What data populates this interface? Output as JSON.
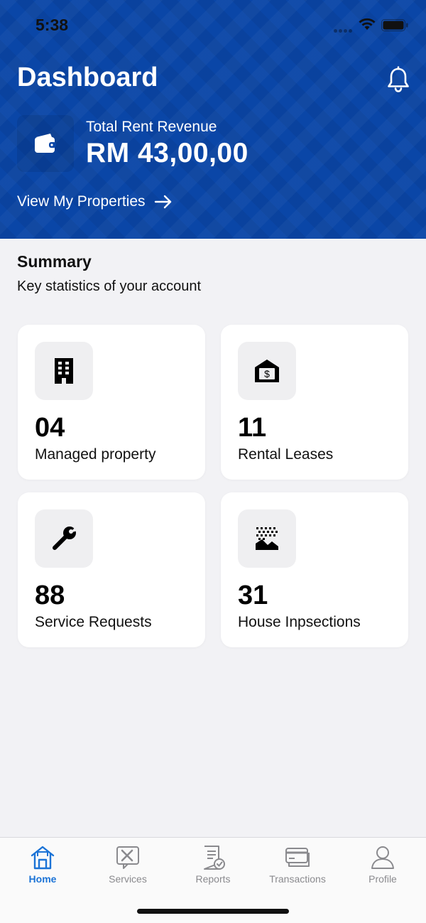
{
  "status_bar": {
    "time": "5:38"
  },
  "header": {
    "title": "Dashboard",
    "revenue_label": "Total Rent Revenue",
    "revenue_value": "RM 43,00,00",
    "view_link": "View My Properties"
  },
  "summary": {
    "title": "Summary",
    "subtitle": "Key statistics of your account",
    "cards": [
      {
        "value": "04",
        "label": "Managed property",
        "icon": "building-icon"
      },
      {
        "value": "11",
        "label": "Rental Leases",
        "icon": "house-dollar-icon"
      },
      {
        "value": "88",
        "label": "Service Requests",
        "icon": "wrench-icon"
      },
      {
        "value": "31",
        "label": "House Inpsections",
        "icon": "landscape-inspection-icon"
      }
    ]
  },
  "tabbar": {
    "tabs": [
      {
        "label": "Home",
        "icon": "home-icon",
        "active": true
      },
      {
        "label": "Services",
        "icon": "services-icon",
        "active": false
      },
      {
        "label": "Reports",
        "icon": "reports-icon",
        "active": false
      },
      {
        "label": "Transactions",
        "icon": "transactions-icon",
        "active": false
      },
      {
        "label": "Profile",
        "icon": "profile-icon",
        "active": false
      }
    ]
  },
  "colors": {
    "header_bg": "#0a46a7",
    "active_tab": "#1b73d6",
    "inactive_tab": "#8a8a8e"
  }
}
